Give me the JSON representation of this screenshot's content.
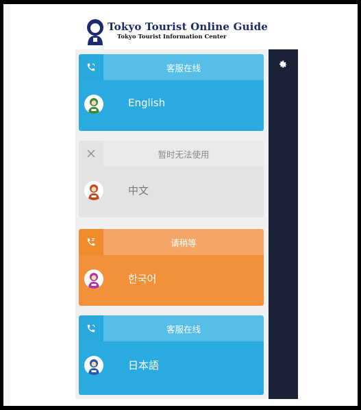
{
  "header": {
    "brand_title": "Tokyo Tourist Online Guide",
    "brand_subtitle": "Tokyo Tourist Information Center"
  },
  "sidebar": {
    "settings_icon": "gear-icon"
  },
  "colors": {
    "online_blue": "#29abe0",
    "unavailable_gray": "#e3e3e3",
    "waiting_orange": "#f2913a",
    "side_panel": "#1b2238"
  },
  "cards": [
    {
      "status": "客服在线",
      "language": "English",
      "state": "online",
      "icon": "phone-icon",
      "avatar_color": "#3a8a3a"
    },
    {
      "status": "暂时无法使用",
      "language": "中文",
      "state": "unavailable",
      "icon": "close-icon",
      "avatar_color": "#c2491f"
    },
    {
      "status": "请稍等",
      "language": "한국어",
      "state": "waiting",
      "icon": "phone-wait-icon",
      "avatar_color": "#b2339c"
    },
    {
      "status": "客服在线",
      "language": "日本語",
      "state": "online",
      "icon": "phone-icon",
      "avatar_color": "#1e5aa8"
    }
  ]
}
